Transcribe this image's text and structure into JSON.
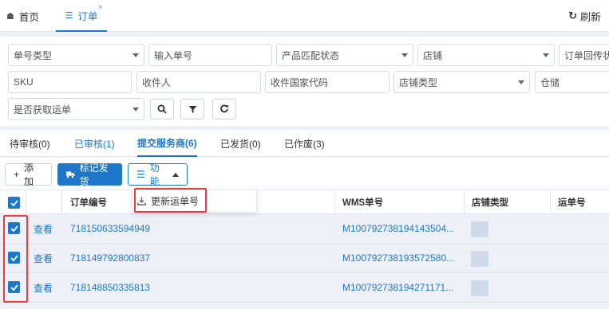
{
  "tabs": {
    "home": "首页",
    "order": "订单",
    "close": "×",
    "refresh": "刷新"
  },
  "filters": {
    "row1": [
      "单号类型",
      "输入单号",
      "产品匹配状态",
      "店铺",
      "订单回传状态"
    ],
    "row2": [
      "SKU",
      "收件人",
      "收件国家代码",
      "店铺类型",
      "仓储"
    ],
    "row3": [
      "是否获取运单"
    ]
  },
  "status_tabs": [
    "待审核(0)",
    "已审核(1)",
    "提交服务商(6)",
    "已发货(0)",
    "已作废(3)"
  ],
  "toolbar": {
    "add": "添加",
    "ship": "标记发货",
    "func": "功能"
  },
  "menu": {
    "update_waybill": "更新运单号"
  },
  "table": {
    "columns": [
      "订单编号",
      "WMS单号",
      "店铺类型",
      "运单号"
    ],
    "view_label": "查看",
    "rows": [
      {
        "order": "718150633594949",
        "wms": "M100792738194143504..."
      },
      {
        "order": "718149792800837",
        "wms": "M100792738193572580..."
      },
      {
        "order": "718148850335813",
        "wms": "M100792738194271171..."
      }
    ]
  },
  "colors": {
    "accent": "#1e77c9",
    "highlight": "#ec3b3b"
  }
}
